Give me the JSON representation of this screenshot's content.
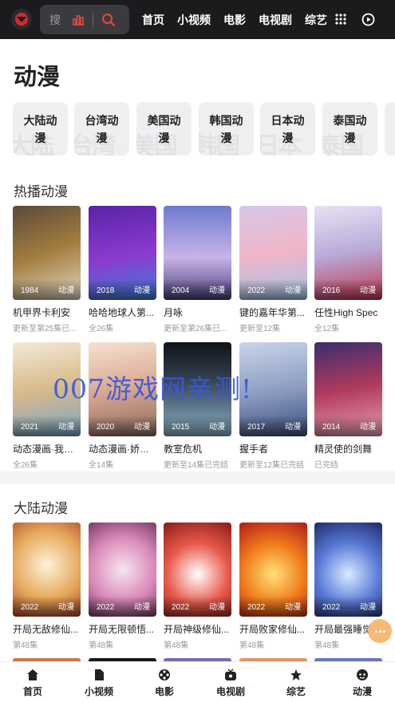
{
  "header": {
    "search_placeholder": "搜",
    "nav": [
      "首页",
      "小视频",
      "电影",
      "电视剧",
      "综艺"
    ]
  },
  "page": {
    "title": "动漫"
  },
  "categories": [
    {
      "label": "大陆动漫",
      "bg": "大陆"
    },
    {
      "label": "台湾动漫",
      "bg": "台湾"
    },
    {
      "label": "美国动漫",
      "bg": "美国"
    },
    {
      "label": "韩国动漫",
      "bg": "韩国"
    },
    {
      "label": "日本动漫",
      "bg": "日本"
    },
    {
      "label": "泰国动漫",
      "bg": "泰国"
    }
  ],
  "hot": {
    "title": "热播动漫",
    "items": [
      {
        "title": "机甲界卡利安",
        "sub": "更新至第25集已...",
        "year": "1984",
        "type": "动漫",
        "color": "#8a6a3f"
      },
      {
        "title": "哈哈地球人第...",
        "sub": "全26集",
        "year": "2018",
        "type": "动漫",
        "color": "#6a2fb0"
      },
      {
        "title": "月咏",
        "sub": "更新至第26集已...",
        "year": "2004",
        "type": "动漫",
        "color": "#5a5fb2"
      },
      {
        "title": "键的嘉年华第...",
        "sub": "更新至12集",
        "year": "2022",
        "type": "动漫",
        "color": "#c8a8d8"
      },
      {
        "title": "任性High Spec",
        "sub": "全12集",
        "year": "2016",
        "type": "动漫",
        "color": "#b8b0d8"
      },
      {
        "title": "动态漫画·我能...",
        "sub": "全26集",
        "year": "2021",
        "type": "动漫",
        "color": "#d9c49a"
      },
      {
        "title": "动态漫画·娇女...",
        "sub": "全14集",
        "year": "2020",
        "type": "动漫",
        "color": "#e0b7a8"
      },
      {
        "title": "教室危机",
        "sub": "更新至14集已完结",
        "year": "2015",
        "type": "动漫",
        "color": "#7d95ad"
      },
      {
        "title": "握手者",
        "sub": "更新至12集已完结",
        "year": "2017",
        "type": "动漫",
        "color": "#5d6f9c"
      },
      {
        "title": "精灵使的剑舞",
        "sub": "已完结",
        "year": "2014",
        "type": "动漫",
        "color": "#b24a6a"
      }
    ]
  },
  "mainland": {
    "title": "大陆动漫",
    "items": [
      {
        "title": "开局无敌修仙...",
        "sub": "第48集",
        "year": "2022",
        "type": "动漫",
        "color": "#d9a05a"
      },
      {
        "title": "开局无限顿悟...",
        "sub": "第48集",
        "year": "2022",
        "type": "动漫",
        "color": "#b05a8a"
      },
      {
        "title": "开局神级修仙...",
        "sub": "第48集",
        "year": "2022",
        "type": "动漫",
        "color": "#c0392b"
      },
      {
        "title": "开局败家修仙...",
        "sub": "第48集",
        "year": "2022",
        "type": "动漫",
        "color": "#d35400"
      },
      {
        "title": "开局最强睡觉...",
        "sub": "第48集",
        "year": "2022",
        "type": "动漫",
        "color": "#3a55a8"
      }
    ]
  },
  "watermark": "007游戏网亲测!",
  "bottom_nav": [
    "首页",
    "小视频",
    "电影",
    "电视剧",
    "综艺",
    "动漫"
  ]
}
